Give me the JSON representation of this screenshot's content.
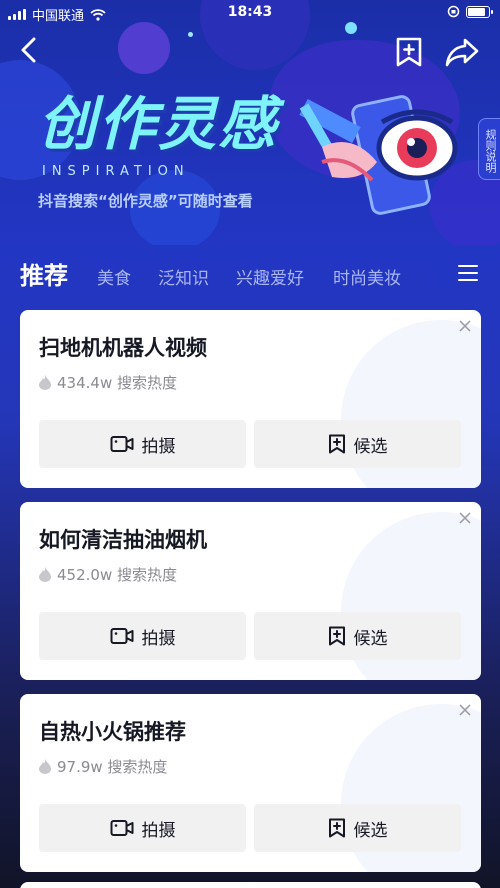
{
  "status_bar": {
    "carrier": "中国联通",
    "time": "18:43"
  },
  "hero": {
    "title": "创作灵感",
    "subtitle_en": "INSPIRATION",
    "hint": "抖音搜索“创作灵感”可随时查看",
    "rules_label": "规则说明"
  },
  "tabs": [
    {
      "label": "推荐",
      "active": true
    },
    {
      "label": "美食",
      "active": false
    },
    {
      "label": "泛知识",
      "active": false
    },
    {
      "label": "兴趣爱好",
      "active": false
    },
    {
      "label": "时尚美妆",
      "active": false
    }
  ],
  "cards": [
    {
      "title": "扫地机机器人视频",
      "heat": "434.4w 搜索热度",
      "shoot_label": "拍摄",
      "candidate_label": "候选"
    },
    {
      "title": "如何清洁抽油烟机",
      "heat": "452.0w 搜索热度",
      "shoot_label": "拍摄",
      "candidate_label": "候选"
    },
    {
      "title": "自热小火锅推荐",
      "heat": "97.9w 搜索热度",
      "shoot_label": "拍摄",
      "candidate_label": "候选"
    }
  ],
  "icons": {
    "back": "chevron-left-icon",
    "bookmark": "bookmark-plus-icon",
    "share": "share-arrow-icon",
    "menu": "hamburger-icon",
    "heat": "flame-icon",
    "close": "close-icon",
    "camera": "video-camera-icon",
    "candidate": "add-bookmark-icon"
  },
  "colors": {
    "hero_title": "#7ef3f8",
    "background": "#2236c4",
    "card": "#ffffff",
    "button": "#f1f1f2"
  }
}
